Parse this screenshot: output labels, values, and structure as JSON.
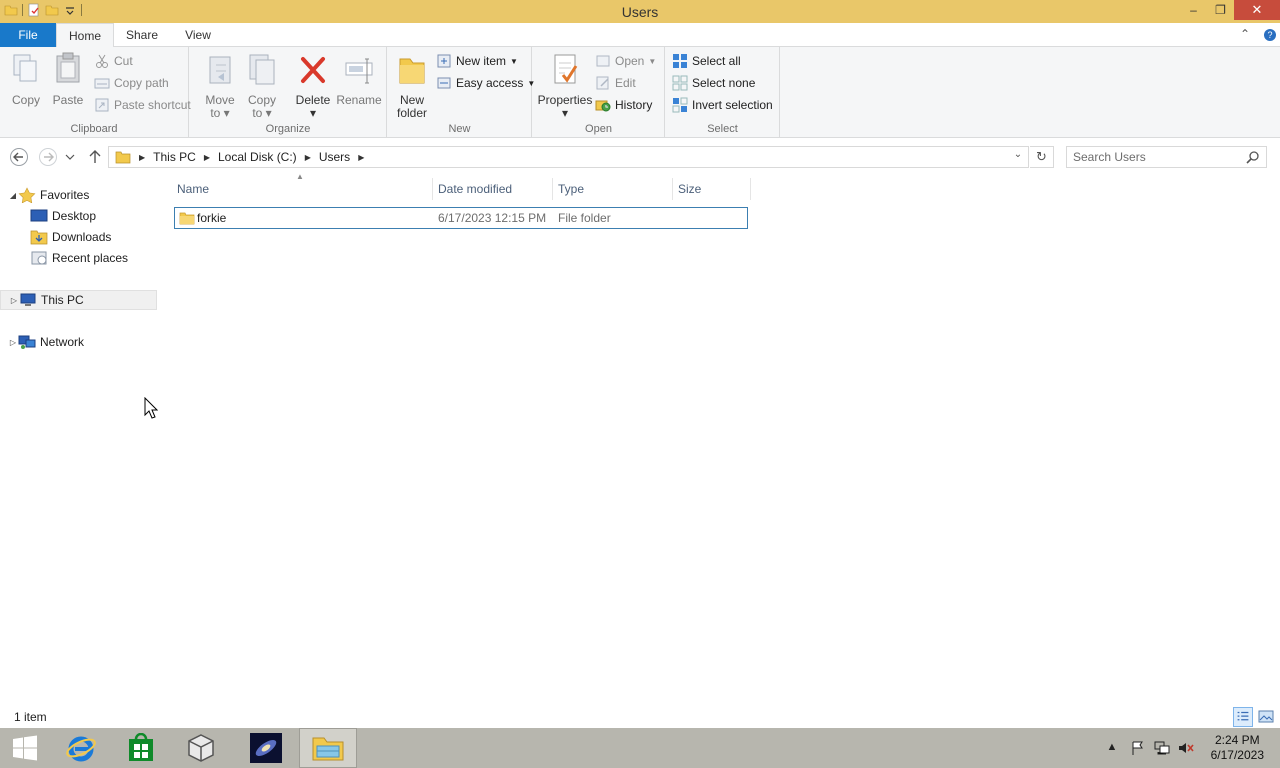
{
  "window": {
    "title": "Users"
  },
  "tabs": {
    "file": "File",
    "home": "Home",
    "share": "Share",
    "view": "View"
  },
  "ribbon": {
    "clipboard": {
      "label": "Clipboard",
      "copy": "Copy",
      "paste": "Paste",
      "cut": "Cut",
      "copy_path": "Copy path",
      "paste_shortcut": "Paste shortcut"
    },
    "organize": {
      "label": "Organize",
      "move_to_1": "Move",
      "move_to_2": "to",
      "copy_to_1": "Copy",
      "copy_to_2": "to",
      "delete": "Delete",
      "rename": "Rename"
    },
    "new": {
      "label": "New",
      "new_folder_1": "New",
      "new_folder_2": "folder",
      "new_item": "New item",
      "easy_access": "Easy access"
    },
    "open": {
      "label": "Open",
      "properties": "Properties",
      "open": "Open",
      "edit": "Edit",
      "history": "History"
    },
    "select": {
      "label": "Select",
      "select_all": "Select all",
      "select_none": "Select none",
      "invert_selection": "Invert selection"
    }
  },
  "address": {
    "crumbs": [
      "This PC",
      "Local Disk (C:)",
      "Users"
    ]
  },
  "search": {
    "placeholder": "Search Users"
  },
  "navpane": {
    "favorites": "Favorites",
    "desktop": "Desktop",
    "downloads": "Downloads",
    "recent_places": "Recent places",
    "this_pc": "This PC",
    "network": "Network"
  },
  "columns": {
    "name": "Name",
    "date_modified": "Date modified",
    "type": "Type",
    "size": "Size"
  },
  "files": [
    {
      "name": "forkie",
      "date": "6/17/2023 12:15 PM",
      "type": "File folder",
      "size": ""
    }
  ],
  "status": {
    "count": "1 item"
  },
  "clock": {
    "time": "2:24 PM",
    "date": "6/17/2023"
  },
  "colors": {
    "titlebar": "#e9c769",
    "file_tab": "#1979ca",
    "close_button": "#c74c3c",
    "selection_border": "#3c7fb1",
    "taskbar": "#b7b6ae"
  }
}
